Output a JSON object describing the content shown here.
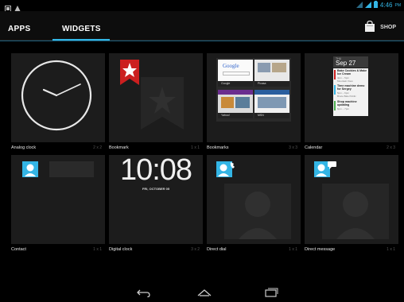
{
  "status_bar": {
    "time": "4:46",
    "ampm": "PM"
  },
  "tabs": [
    {
      "label": "APPS"
    },
    {
      "label": "WIDGETS"
    }
  ],
  "shop": {
    "label": "SHOP"
  },
  "widgets": [
    {
      "label": "Analog clock",
      "span": "2 x 2"
    },
    {
      "label": "Bookmark",
      "span": "1 x 1"
    },
    {
      "label": "Bookmarks",
      "span": "3 x 3"
    },
    {
      "label": "Calendar",
      "span": "2 x 3"
    },
    {
      "label": "Contact",
      "span": "1 x 1"
    },
    {
      "label": "Digital clock",
      "span": "3 x 2"
    },
    {
      "label": "Direct dial",
      "span": "1 x 1"
    },
    {
      "label": "Direct message",
      "span": "1 x 1"
    }
  ],
  "digital_clock": {
    "time": "10:08",
    "date": "FRI, OCTOBER 05"
  },
  "calendar": {
    "day": "THU",
    "date": "Sep 27",
    "events": [
      {
        "title": "Bake Cookies & Make Ice Cream",
        "sub": "4pm – 5pm",
        "loc": "Mountain View"
      },
      {
        "title": "Time machine demo for Sergey",
        "sub": "5pm – 6pm",
        "loc": "Bruce Bale Public"
      },
      {
        "title": "Shop machine updating",
        "sub": "6pm – 7pm",
        "loc": ""
      }
    ]
  },
  "bookmarks_thumbs": [
    {
      "label": "Google"
    },
    {
      "label": "Picasa"
    },
    {
      "label": "Yahoo!"
    },
    {
      "label": "MSN"
    }
  ],
  "colors": {
    "accent": "#33b5e5",
    "bookmark_red": "#cc1f1f"
  }
}
